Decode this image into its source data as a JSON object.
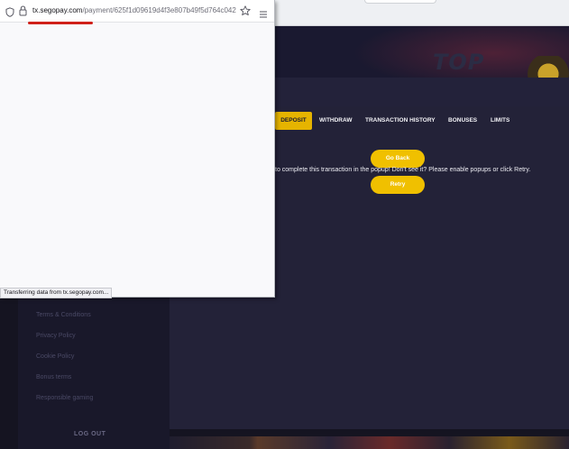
{
  "browser": {
    "url_domain": "tx.segopay.com",
    "url_path": "/payment/625f1d09619d4f3e807b49f5d764c042",
    "status_text": "Transferring data from tx.segopay.com..."
  },
  "banner": {
    "text": "TOP PICKS"
  },
  "tabs": [
    {
      "label": "DEPOSIT",
      "active": true
    },
    {
      "label": "WITHDRAW"
    },
    {
      "label": "TRANSACTION HISTORY"
    },
    {
      "label": "BONUSES"
    },
    {
      "label": "LIMITS"
    }
  ],
  "content": {
    "go_back_label": "Go Back",
    "message": "to complete this transaction in the popup! Don't see it? Please enable popups or click Retry.",
    "retry_label": "Retry"
  },
  "sidebar": {
    "items": [
      "Terms & Conditions",
      "Privacy Policy",
      "Cookie Policy",
      "Bonus terms",
      "Responsible gaming"
    ],
    "logout_label": "LOG OUT"
  },
  "colors": {
    "accent": "#f0c000",
    "background": "#151421",
    "panel": "#232238"
  }
}
